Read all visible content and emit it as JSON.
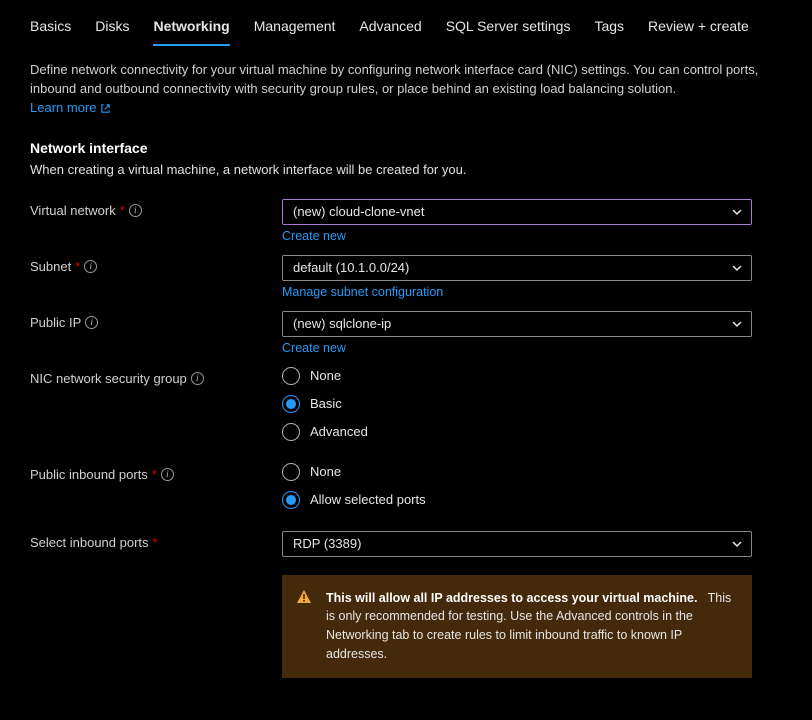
{
  "tabs": [
    {
      "label": "Basics"
    },
    {
      "label": "Disks"
    },
    {
      "label": "Networking"
    },
    {
      "label": "Management"
    },
    {
      "label": "Advanced"
    },
    {
      "label": "SQL Server settings"
    },
    {
      "label": "Tags"
    },
    {
      "label": "Review + create"
    }
  ],
  "activeTabIndex": 2,
  "description": "Define network connectivity for your virtual machine by configuring network interface card (NIC) settings. You can control ports, inbound and outbound connectivity with security group rules, or place behind an existing load balancing solution.",
  "learnMore": "Learn more",
  "section": {
    "title": "Network interface",
    "subtitle": "When creating a virtual machine, a network interface will be created for you."
  },
  "fields": {
    "vnet": {
      "label": "Virtual network",
      "required": true,
      "value": "(new) cloud-clone-vnet",
      "subaction": "Create new"
    },
    "subnet": {
      "label": "Subnet",
      "required": true,
      "value": "default (10.1.0.0/24)",
      "subaction": "Manage subnet configuration"
    },
    "publicIp": {
      "label": "Public IP",
      "required": false,
      "value": "(new) sqlclone-ip",
      "subaction": "Create new"
    },
    "nsg": {
      "label": "NIC network security group",
      "options": [
        "None",
        "Basic",
        "Advanced"
      ],
      "selected": "Basic"
    },
    "inboundPorts": {
      "label": "Public inbound ports",
      "required": true,
      "options": [
        "None",
        "Allow selected ports"
      ],
      "selected": "Allow selected ports"
    },
    "selectPorts": {
      "label": "Select inbound ports",
      "required": true,
      "value": "RDP (3389)"
    }
  },
  "warning": {
    "bold": "This will allow all IP addresses to access your virtual machine.",
    "rest": "This is only recommended for testing.  Use the Advanced controls in the Networking tab to create rules to limit inbound traffic to known IP addresses."
  }
}
